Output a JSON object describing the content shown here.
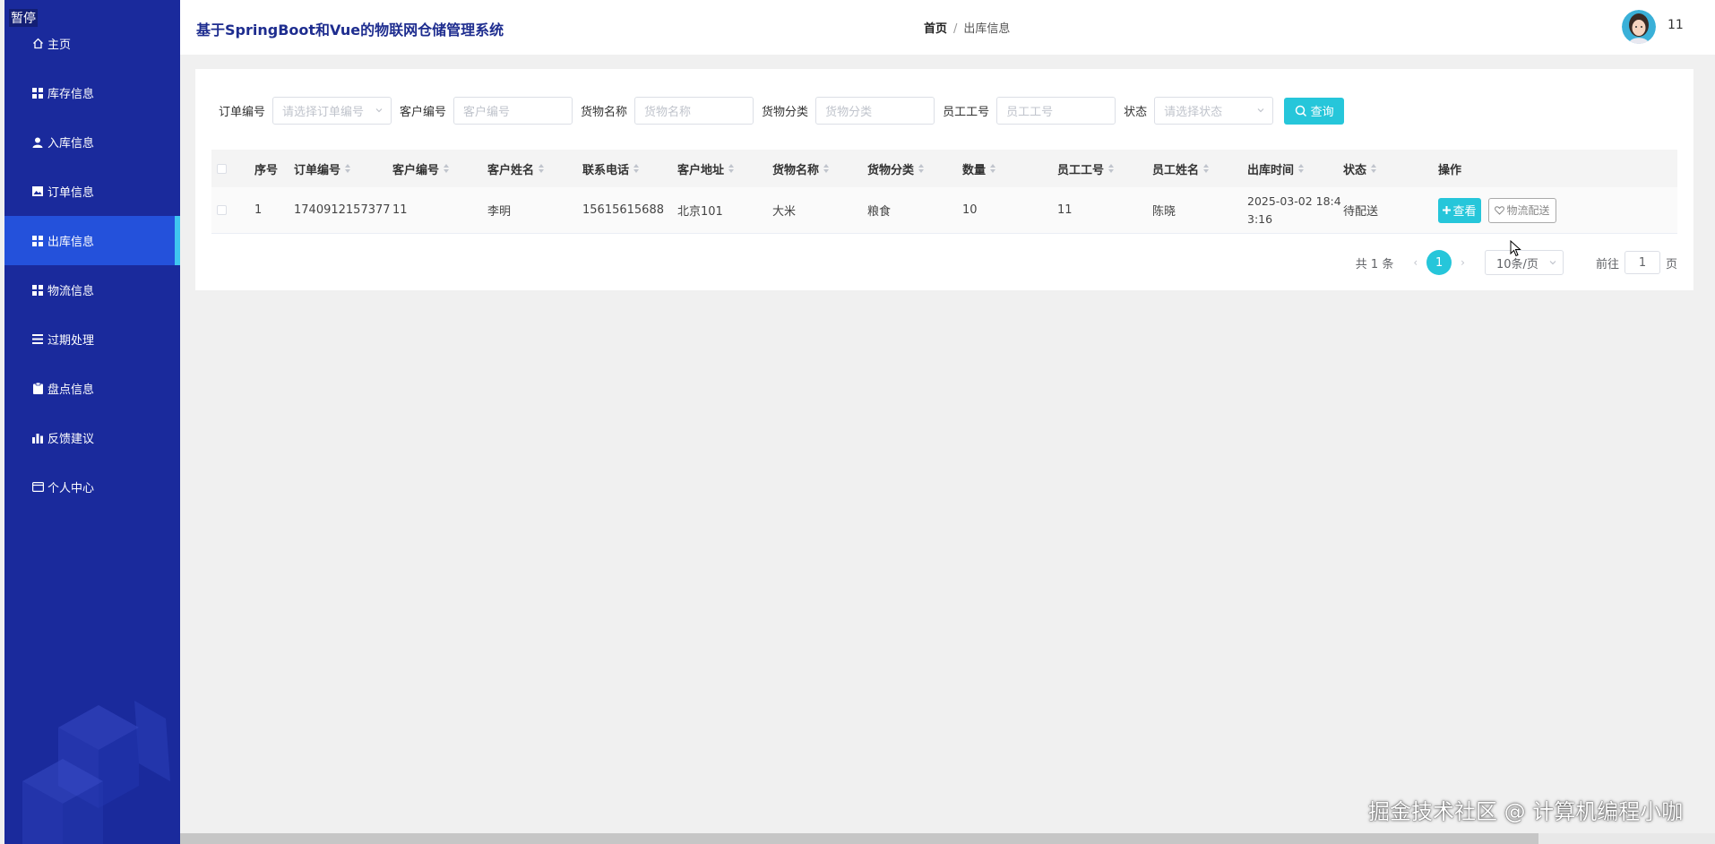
{
  "overlay": {
    "pause_label": "暂停"
  },
  "sidebar": {
    "items": [
      {
        "label": "主页",
        "icon": "home-icon"
      },
      {
        "label": "库存信息",
        "icon": "grid-icon"
      },
      {
        "label": "入库信息",
        "icon": "user-icon"
      },
      {
        "label": "订单信息",
        "icon": "image-icon"
      },
      {
        "label": "出库信息",
        "icon": "grid-icon",
        "active": true
      },
      {
        "label": "物流信息",
        "icon": "grid-icon"
      },
      {
        "label": "过期处理",
        "icon": "list-icon"
      },
      {
        "label": "盘点信息",
        "icon": "clipboard-icon"
      },
      {
        "label": "反馈建议",
        "icon": "bar-chart-icon"
      },
      {
        "label": "个人中心",
        "icon": "card-icon"
      }
    ]
  },
  "header": {
    "title": "基于SpringBoot和Vue的物联网仓储管理系统",
    "breadcrumb": {
      "home": "首页",
      "separator": "/",
      "current": "出库信息"
    },
    "username": "11"
  },
  "search": {
    "order_no_label": "订单编号",
    "order_no_placeholder": "请选择订单编号",
    "customer_no_label": "客户编号",
    "customer_no_placeholder": "客户编号",
    "goods_name_label": "货物名称",
    "goods_name_placeholder": "货物名称",
    "goods_category_label": "货物分类",
    "goods_category_placeholder": "货物分类",
    "employee_no_label": "员工工号",
    "employee_no_placeholder": "员工工号",
    "status_label": "状态",
    "status_placeholder": "请选择状态",
    "query_button": "查询"
  },
  "table": {
    "headers": {
      "index": "序号",
      "order_no": "订单编号",
      "customer_no": "客户编号",
      "customer_name": "客户姓名",
      "phone": "联系电话",
      "address": "客户地址",
      "goods_name": "货物名称",
      "goods_category": "货物分类",
      "quantity": "数量",
      "employee_no": "员工工号",
      "employee_name": "员工姓名",
      "out_time": "出库时间",
      "status": "状态",
      "actions": "操作"
    },
    "rows": [
      {
        "index": "1",
        "order_no": "1740912157377",
        "customer_no": "11",
        "customer_name": "李明",
        "phone": "15615615688",
        "address": "北京101",
        "goods_name": "大米",
        "goods_category": "粮食",
        "quantity": "10",
        "employee_no": "11",
        "employee_name": "陈晓",
        "out_time_line1": "2025-03-02 18:4",
        "out_time_line2": "3:16",
        "status": "待配送",
        "view_button": "查看",
        "logistics_button": "物流配送"
      }
    ]
  },
  "pagination": {
    "total": "共 1 条",
    "current_page": "1",
    "page_size": "10条/页",
    "goto_prefix": "前往",
    "goto_value": "1",
    "goto_suffix": "页"
  },
  "watermark": "掘金技术社区 @ 计算机编程小咖",
  "colors": {
    "sidebar": "#1a2a9c",
    "sidebar_active": "#2451db",
    "accent": "#26c6da",
    "title": "#1e2d8f"
  }
}
